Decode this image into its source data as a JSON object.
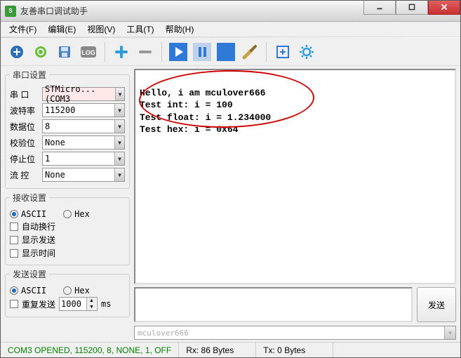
{
  "window": {
    "title": "友善串口调试助手"
  },
  "menu": {
    "file": "文件(F)",
    "edit": "编辑(E)",
    "view": "视图(V)",
    "tools": "工具(T)",
    "help": "帮助(H)"
  },
  "serial_settings": {
    "legend": "串口设置",
    "port_label": "串  口",
    "port_value": "STMicro...(COM3",
    "baud_label": "波特率",
    "baud_value": "115200",
    "databits_label": "数据位",
    "databits_value": "8",
    "parity_label": "校验位",
    "parity_value": "None",
    "stopbits_label": "停止位",
    "stopbits_value": "1",
    "flow_label": "流  控",
    "flow_value": "None"
  },
  "recv_settings": {
    "legend": "接收设置",
    "ascii": "ASCII",
    "hex": "Hex",
    "auto_wrap": "自动换行",
    "show_send": "显示发送",
    "show_time": "显示时间"
  },
  "send_settings": {
    "legend": "发送设置",
    "ascii": "ASCII",
    "hex": "Hex",
    "repeat": "重复发送",
    "interval": "1000",
    "unit": "ms"
  },
  "output": {
    "line1": "Hello, i am mculover666",
    "line2": "Test int: i = 100",
    "line3": "Test float: i = 1.234000",
    "line4": "Test hex: i = 0x64"
  },
  "send_button": "发送",
  "send_input_placeholder": "mculover666",
  "status": {
    "conn": "COM3 OPENED, 115200, 8, NONE, 1, OFF",
    "rx": "Rx: 86 Bytes",
    "tx": "Tx: 0 Bytes"
  },
  "chart_data": null
}
